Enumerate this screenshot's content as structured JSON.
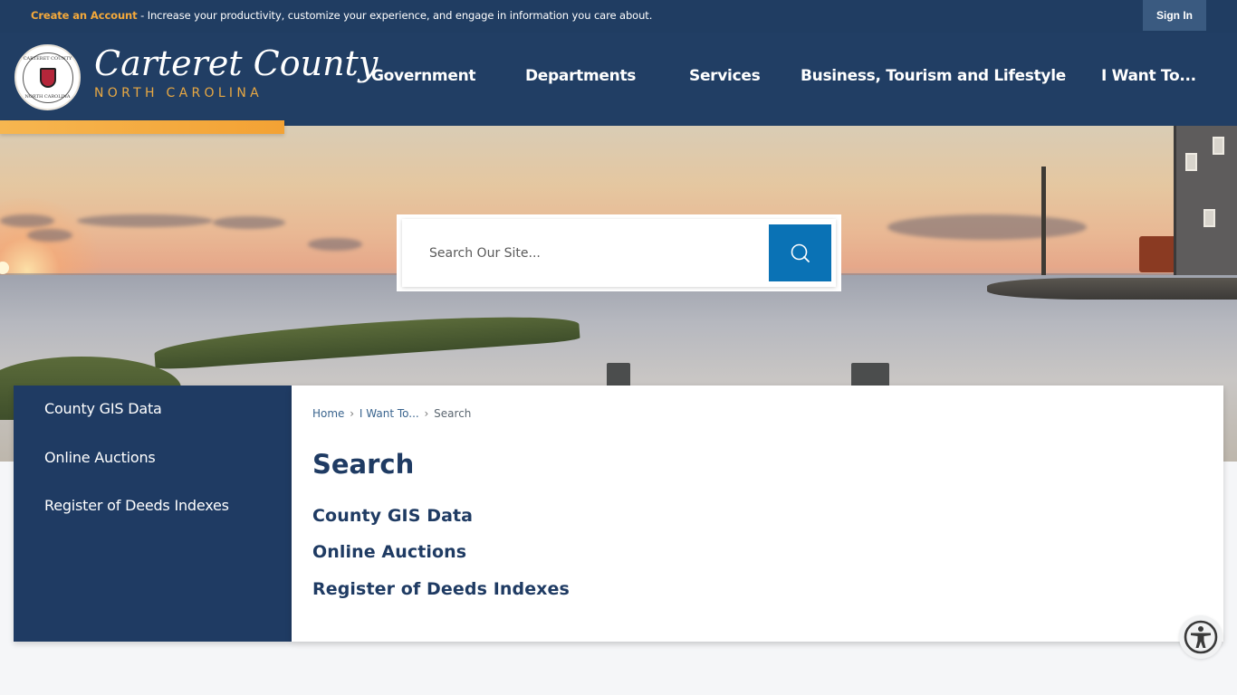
{
  "topbar": {
    "create_account_label": "Create an Account",
    "message": " - Increase your productivity, customize your experience, and engage in information you care about.",
    "sign_in_label": "Sign In"
  },
  "header": {
    "logo_title": "Carteret County",
    "logo_subtitle": "NORTH CAROLINA",
    "seal_text_top": "CARTERET COUNTY",
    "seal_text_bottom": "NORTH CAROLINA",
    "nav": [
      {
        "label": "Government"
      },
      {
        "label": "Departments"
      },
      {
        "label": "Services"
      },
      {
        "label": "Business, Tourism and Lifestyle"
      },
      {
        "label": "I Want To..."
      }
    ]
  },
  "search": {
    "placeholder": "Search Our Site...",
    "value": "",
    "button_icon": "search-icon"
  },
  "sidebar": {
    "items": [
      {
        "label": "County GIS Data"
      },
      {
        "label": "Online Auctions"
      },
      {
        "label": "Register of Deeds Indexes"
      }
    ]
  },
  "breadcrumb": {
    "items": [
      {
        "label": "Home"
      },
      {
        "label": "I Want To..."
      }
    ],
    "separator": "›",
    "current": "Search"
  },
  "main": {
    "title": "Search",
    "results": [
      {
        "label": "County GIS Data"
      },
      {
        "label": "Online Auctions"
      },
      {
        "label": "Register of Deeds Indexes"
      }
    ]
  },
  "accessibility": {
    "icon": "accessibility-icon"
  },
  "colors": {
    "navy": "#203d62",
    "orange": "#f4a93b",
    "search_blue": "#0a72b5",
    "page_bg": "#f5f6f8"
  }
}
